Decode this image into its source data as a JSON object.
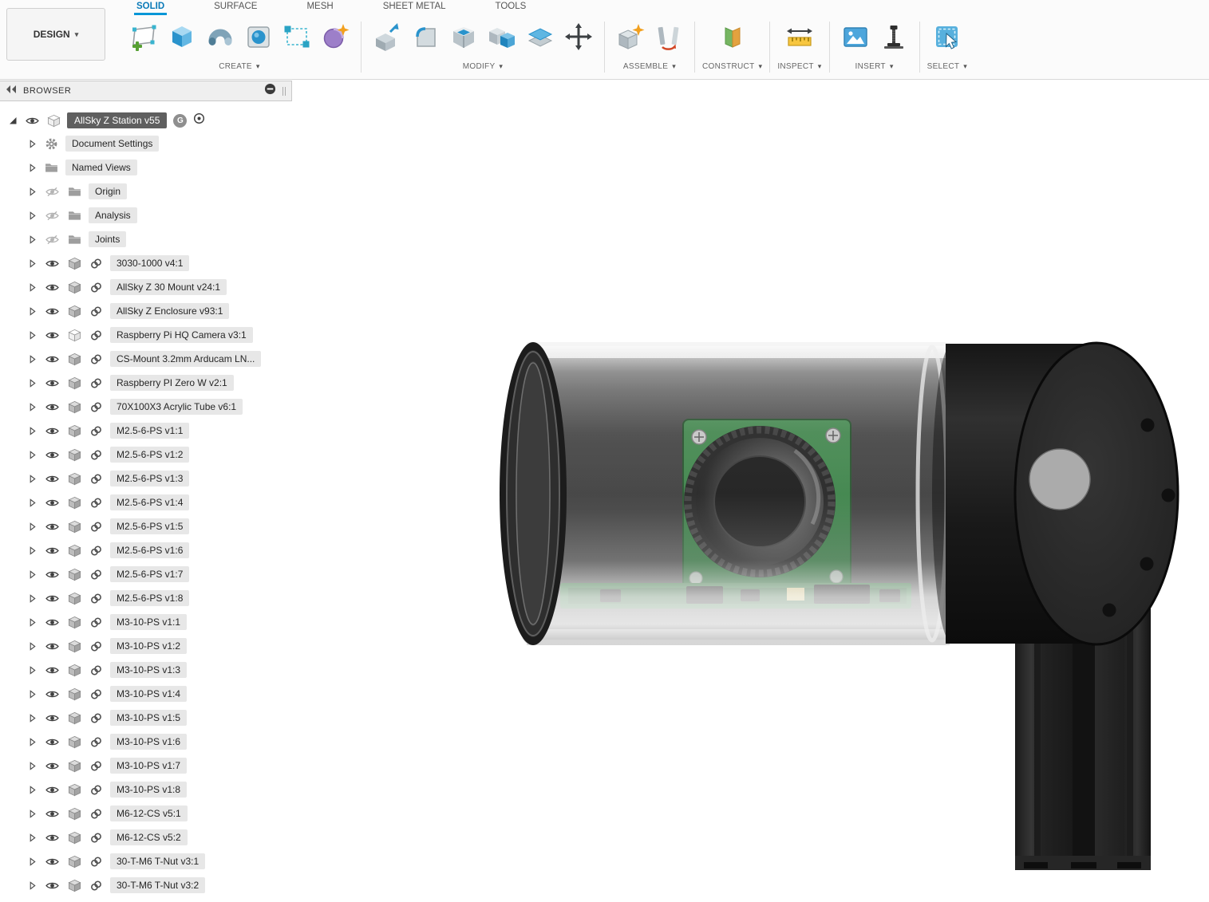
{
  "colors": {
    "accent_blue": "#0696d7",
    "tab_underline": "#0696d7",
    "pcb_green": "#2c7a3a",
    "selected_item_bg": "#5f5f5f"
  },
  "toolbar": {
    "design_label": "DESIGN",
    "tabs": [
      {
        "label": "SOLID",
        "active": true
      },
      {
        "label": "SURFACE",
        "active": false
      },
      {
        "label": "MESH",
        "active": false
      },
      {
        "label": "SHEET METAL",
        "active": false
      },
      {
        "label": "TOOLS",
        "active": false
      }
    ],
    "groups": [
      {
        "label": "CREATE",
        "icons": [
          "create-sketch",
          "extrude",
          "revolve",
          "primitive",
          "rectangular-pattern",
          "create-form"
        ]
      },
      {
        "label": "MODIFY",
        "icons": [
          "press-pull",
          "fillet",
          "shell",
          "combine",
          "offset-face",
          "move-copy"
        ]
      },
      {
        "label": "ASSEMBLE",
        "icons": [
          "new-component",
          "joint"
        ]
      },
      {
        "label": "CONSTRUCT",
        "icons": [
          "construction-plane"
        ]
      },
      {
        "label": "INSPECT",
        "icons": [
          "measure"
        ]
      },
      {
        "label": "INSERT",
        "icons": [
          "insert-canvas",
          "insert-mcmaster"
        ]
      },
      {
        "label": "SELECT",
        "icons": [
          "select"
        ]
      }
    ]
  },
  "browser": {
    "title": "BROWSER",
    "root": {
      "label": "AllSky Z Station v55",
      "badge": "G"
    },
    "items": [
      {
        "label": "Document Settings",
        "icon": "gear",
        "eye": "none",
        "link": false
      },
      {
        "label": "Named Views",
        "icon": "folder",
        "eye": "none",
        "link": false
      },
      {
        "label": "Origin",
        "icon": "folder",
        "eye": "off",
        "link": false
      },
      {
        "label": "Analysis",
        "icon": "folder",
        "eye": "off",
        "link": false
      },
      {
        "label": "Joints",
        "icon": "folder",
        "eye": "off",
        "link": false
      },
      {
        "label": "3030-1000 v4:1",
        "icon": "component",
        "eye": "on",
        "link": true
      },
      {
        "label": "AllSky Z 30 Mount v24:1",
        "icon": "component",
        "eye": "on",
        "link": true
      },
      {
        "label": "AllSky Z Enclosure v93:1",
        "icon": "component",
        "eye": "on",
        "link": true
      },
      {
        "label": "Raspberry Pi HQ Camera v3:1",
        "icon": "body",
        "eye": "on",
        "link": true
      },
      {
        "label": "CS-Mount 3.2mm Arducam LN...",
        "icon": "component",
        "eye": "on",
        "link": true
      },
      {
        "label": "Raspberry PI Zero W v2:1",
        "icon": "component",
        "eye": "on",
        "link": true
      },
      {
        "label": "70X100X3 Acrylic Tube v6:1",
        "icon": "component",
        "eye": "on",
        "link": true
      },
      {
        "label": "M2.5-6-PS v1:1",
        "icon": "component",
        "eye": "on",
        "link": true
      },
      {
        "label": "M2.5-6-PS v1:2",
        "icon": "component",
        "eye": "on",
        "link": true
      },
      {
        "label": "M2.5-6-PS v1:3",
        "icon": "component",
        "eye": "on",
        "link": true
      },
      {
        "label": "M2.5-6-PS v1:4",
        "icon": "component",
        "eye": "on",
        "link": true
      },
      {
        "label": "M2.5-6-PS v1:5",
        "icon": "component",
        "eye": "on",
        "link": true
      },
      {
        "label": "M2.5-6-PS v1:6",
        "icon": "component",
        "eye": "on",
        "link": true
      },
      {
        "label": "M2.5-6-PS v1:7",
        "icon": "component",
        "eye": "on",
        "link": true
      },
      {
        "label": "M2.5-6-PS v1:8",
        "icon": "component",
        "eye": "on",
        "link": true
      },
      {
        "label": "M3-10-PS v1:1",
        "icon": "component",
        "eye": "on",
        "link": true
      },
      {
        "label": "M3-10-PS v1:2",
        "icon": "component",
        "eye": "on",
        "link": true
      },
      {
        "label": "M3-10-PS v1:3",
        "icon": "component",
        "eye": "on",
        "link": true
      },
      {
        "label": "M3-10-PS v1:4",
        "icon": "component",
        "eye": "on",
        "link": true
      },
      {
        "label": "M3-10-PS v1:5",
        "icon": "component",
        "eye": "on",
        "link": true
      },
      {
        "label": "M3-10-PS v1:6",
        "icon": "component",
        "eye": "on",
        "link": true
      },
      {
        "label": "M3-10-PS v1:7",
        "icon": "component",
        "eye": "on",
        "link": true
      },
      {
        "label": "M3-10-PS v1:8",
        "icon": "component",
        "eye": "on",
        "link": true
      },
      {
        "label": "M6-12-CS v5:1",
        "icon": "component",
        "eye": "on",
        "link": true
      },
      {
        "label": "M6-12-CS v5:2",
        "icon": "component",
        "eye": "on",
        "link": true
      },
      {
        "label": "30-T-M6 T-Nut v3:1",
        "icon": "component",
        "eye": "on",
        "link": true
      },
      {
        "label": "30-T-M6 T-Nut v3:2",
        "icon": "component",
        "eye": "on",
        "link": true
      }
    ]
  }
}
